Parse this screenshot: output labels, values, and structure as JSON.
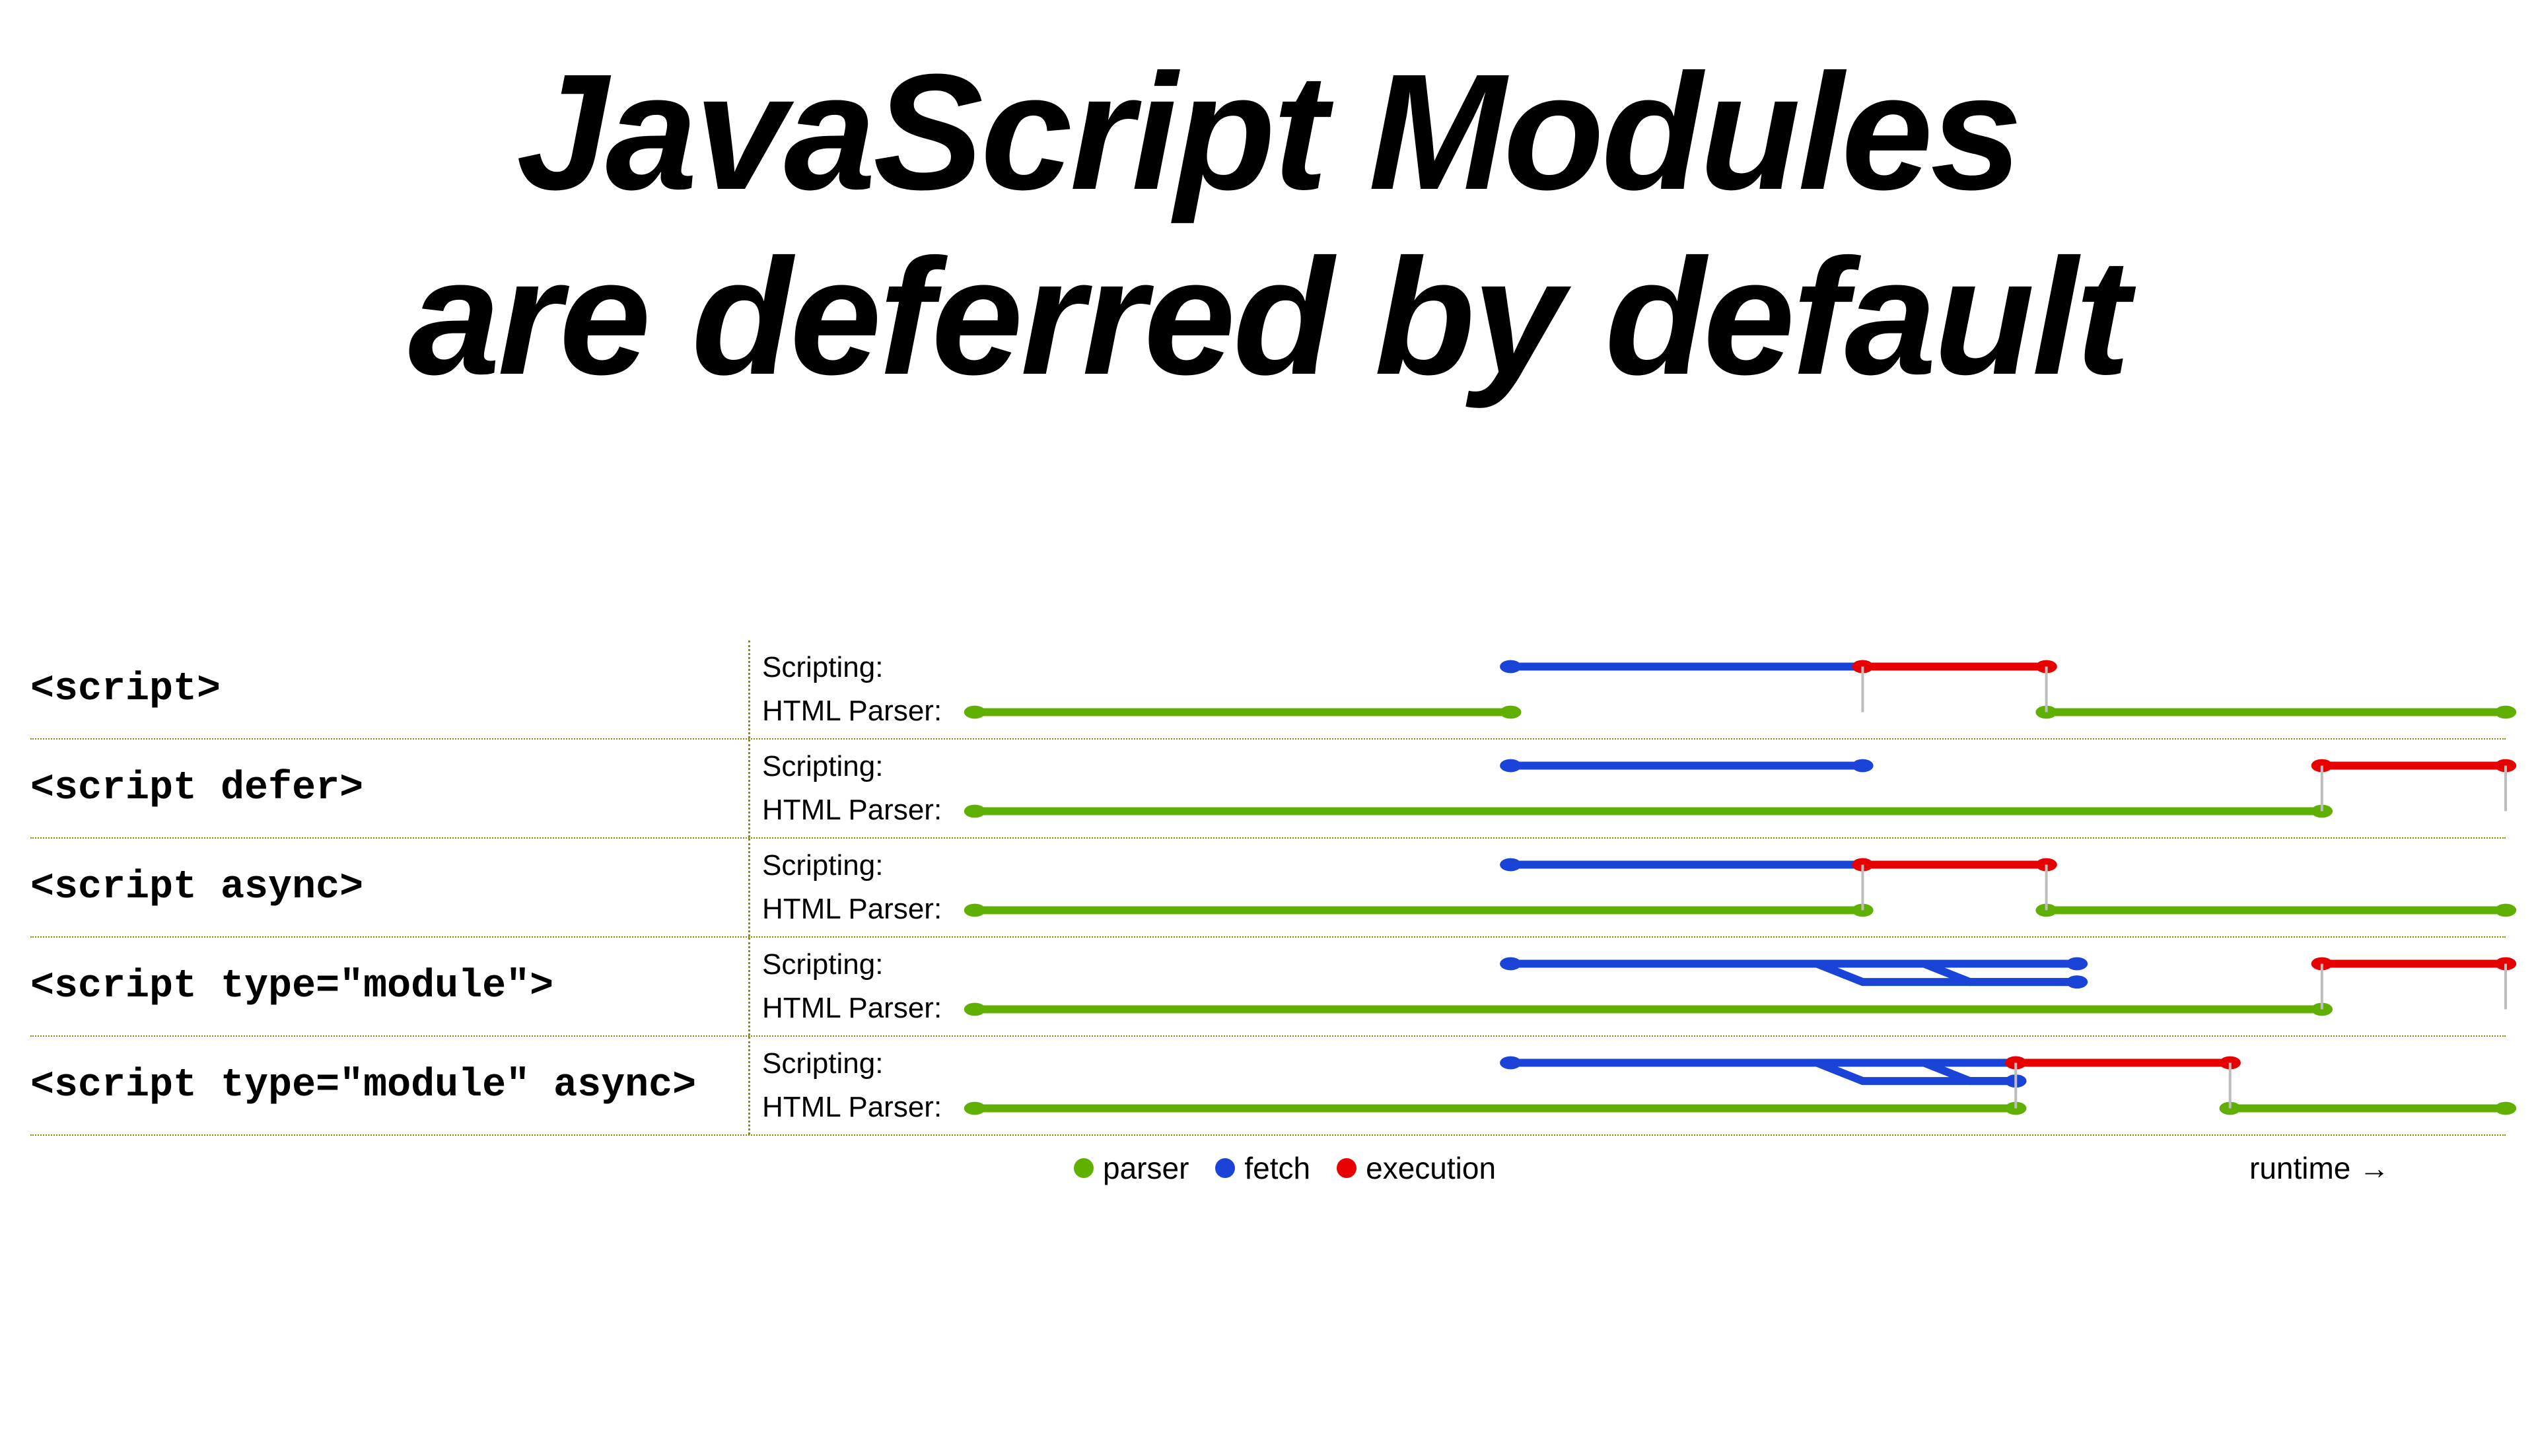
{
  "title_line1": "JavaScript Modules",
  "title_line2": "are deferred by default",
  "rows": {
    "labels": {
      "scripting": "Scripting:",
      "parser": "HTML Parser:"
    },
    "r0": {
      "tag": "<script>"
    },
    "r1": {
      "tag": "<script defer>"
    },
    "r2": {
      "tag": "<script async>"
    },
    "r3": {
      "tag": "<script type=\"module\">"
    },
    "r4": {
      "tag": "<script type=\"module\" async>"
    }
  },
  "legend": {
    "parser": "parser",
    "fetch": "fetch",
    "execution": "execution"
  },
  "runtime_label": "runtime →",
  "chart_data": {
    "type": "timeline",
    "x_range": [
      0,
      100
    ],
    "colors": {
      "parser": "#5fb000",
      "fetch": "#1a44d8",
      "execution": "#e60000"
    },
    "legend": [
      "parser",
      "fetch",
      "execution"
    ],
    "xlabel": "runtime →",
    "rows": [
      {
        "tag": "<script>",
        "scripting": [
          {
            "kind": "fetch",
            "from": 35,
            "to": 58
          },
          {
            "kind": "execution",
            "from": 58,
            "to": 70
          }
        ],
        "parser": [
          {
            "kind": "parser",
            "from": 0,
            "to": 35
          },
          {
            "kind": "parser",
            "from": 70,
            "to": 100
          }
        ],
        "module_fetch_branches": []
      },
      {
        "tag": "<script defer>",
        "scripting": [
          {
            "kind": "fetch",
            "from": 35,
            "to": 58
          },
          {
            "kind": "execution",
            "from": 88,
            "to": 100
          }
        ],
        "parser": [
          {
            "kind": "parser",
            "from": 0,
            "to": 88
          }
        ],
        "module_fetch_branches": []
      },
      {
        "tag": "<script async>",
        "scripting": [
          {
            "kind": "fetch",
            "from": 35,
            "to": 58
          },
          {
            "kind": "execution",
            "from": 58,
            "to": 70
          }
        ],
        "parser": [
          {
            "kind": "parser",
            "from": 0,
            "to": 58
          },
          {
            "kind": "parser",
            "from": 70,
            "to": 100
          }
        ],
        "module_fetch_branches": []
      },
      {
        "tag": "<script type=\"module\">",
        "scripting": [
          {
            "kind": "fetch",
            "from": 35,
            "to": 72
          },
          {
            "kind": "execution",
            "from": 88,
            "to": 100
          }
        ],
        "parser": [
          {
            "kind": "parser",
            "from": 0,
            "to": 88
          }
        ],
        "module_fetch_branches": [
          {
            "from_parent_x": 55,
            "to": 72
          },
          {
            "from_parent_x": 62,
            "to": 72
          }
        ]
      },
      {
        "tag": "<script type=\"module\" async>",
        "scripting": [
          {
            "kind": "fetch",
            "from": 35,
            "to": 68
          },
          {
            "kind": "execution",
            "from": 68,
            "to": 82
          }
        ],
        "parser": [
          {
            "kind": "parser",
            "from": 0,
            "to": 68
          },
          {
            "kind": "parser",
            "from": 82,
            "to": 100
          }
        ],
        "module_fetch_branches": [
          {
            "from_parent_x": 55,
            "to": 68
          },
          {
            "from_parent_x": 62,
            "to": 68
          }
        ]
      }
    ]
  }
}
